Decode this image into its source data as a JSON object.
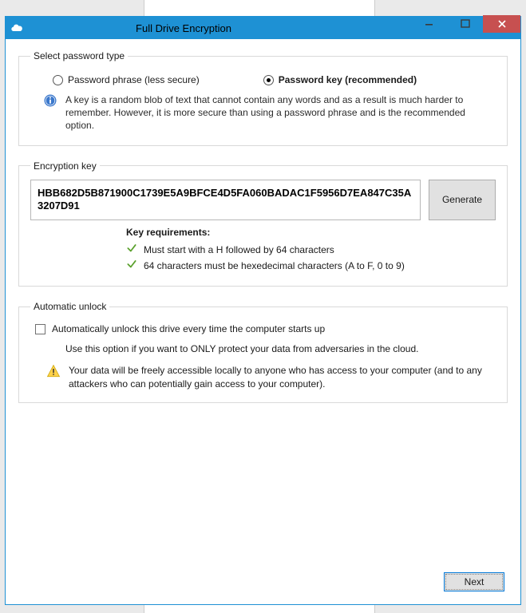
{
  "window": {
    "title": "Full Drive Encryption"
  },
  "password_type": {
    "legend": "Select password type",
    "options": {
      "phrase": {
        "label": "Password phrase (less secure)",
        "selected": false
      },
      "key": {
        "label": "Password key (recommended)",
        "selected": true
      }
    },
    "info": "A key is a random blob of text that cannot contain any words and as a result is much harder to remember. However, it is more secure than using a password phrase and is the recommended option."
  },
  "encryption_key": {
    "legend": "Encryption key",
    "value": "HBB682D5B871900C1739E5A9BFCE4D5FA060BADAC1F5956D7EA847C35A3207D91",
    "generate_label": "Generate",
    "requirements": {
      "title": "Key requirements:",
      "items": [
        "Must start with a H followed by 64 characters",
        "64 characters must be hexedecimal characters (A to F, 0 to 9)"
      ]
    }
  },
  "auto_unlock": {
    "legend": "Automatic unlock",
    "checkbox_label": "Automatically unlock this drive every time the computer starts up",
    "checked": false,
    "info1": "Use this option if you want to ONLY protect your data from adversaries in the cloud.",
    "info2": "Your data will be freely accessible locally to anyone who has access to your computer (and to any attackers who can potentially gain access to your computer)."
  },
  "footer": {
    "next_label": "Next"
  }
}
